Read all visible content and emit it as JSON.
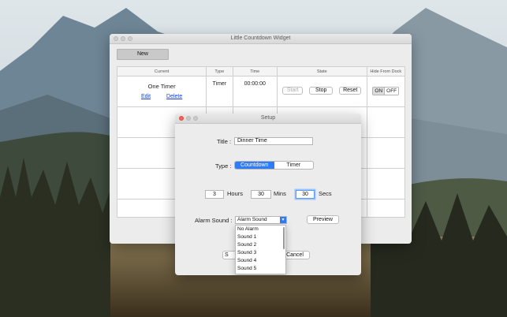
{
  "main_window": {
    "title": "Little Countdown Widget",
    "new_label": "New",
    "columns": [
      "Current",
      "Type",
      "Time",
      "State",
      "Hide From Dock"
    ],
    "row": {
      "name": "One Timer",
      "edit_label": "Edit",
      "delete_label": "Delete",
      "type": "Timer",
      "time": "00:00:00",
      "start_label": "Start",
      "stop_label": "Stop",
      "reset_label": "Reset",
      "on_label": "ON",
      "off_label": "OFF"
    }
  },
  "setup": {
    "title": "Setup",
    "title_label": "Title :",
    "title_value": "Dinner Time",
    "type_label": "Type :",
    "type_options": [
      "Countdown",
      "Timer"
    ],
    "type_selected": "Countdown",
    "hours_value": "3",
    "hours_label": "Hours",
    "mins_value": "30",
    "mins_label": "Mins",
    "secs_value": "30",
    "secs_label": "Secs",
    "alarm_label": "Alarm Sound :",
    "alarm_selected": "Alarm Sound",
    "preview_label": "Preview",
    "save_label": "S",
    "cancel_label": "Cancel",
    "alarm_options": [
      "No Alarm",
      "Sound 1",
      "Sound 2",
      "Sound 3",
      "Sound 4",
      "Sound 5"
    ]
  },
  "colors": {
    "accent": "#2f7cf6",
    "link": "#1a3fd6",
    "close_light": "#fc5f57"
  }
}
